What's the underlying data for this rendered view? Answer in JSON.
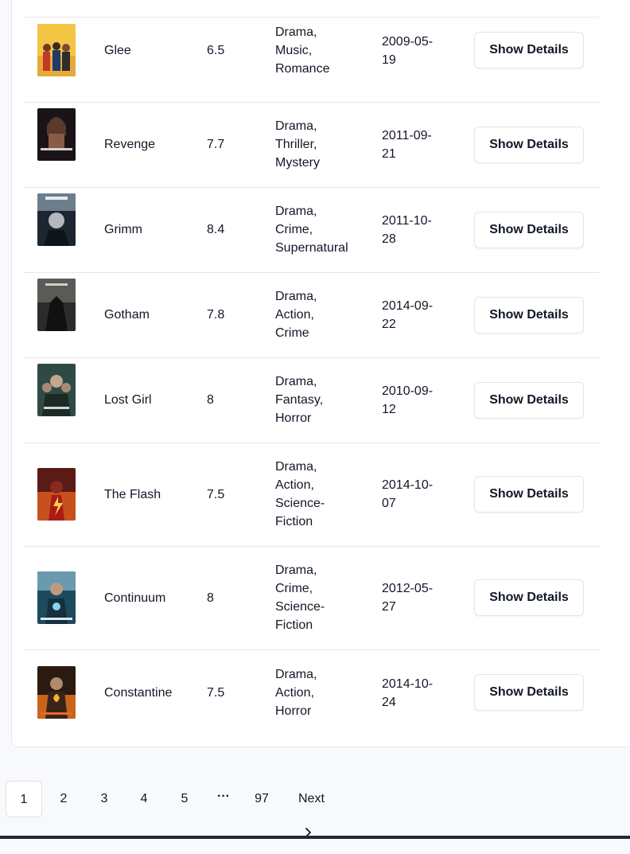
{
  "table": {
    "button_label": "Show Details",
    "rows": [
      {
        "name": "Glee",
        "rating": "6.5",
        "genres": [
          "Drama,",
          "Music,",
          "Romance"
        ],
        "date": [
          "2009-05-",
          "19"
        ],
        "poster_icon": "glee-poster"
      },
      {
        "name": "Revenge",
        "rating": "7.7",
        "genres": [
          "Drama,",
          "Thriller,",
          "Mystery"
        ],
        "date": [
          "2011-09-",
          "21"
        ],
        "poster_icon": "revenge-poster"
      },
      {
        "name": "Grimm",
        "rating": "8.4",
        "genres": [
          "Drama,",
          "Crime,",
          "Supernatural"
        ],
        "date": [
          "2011-10-",
          "28"
        ],
        "poster_icon": "grimm-poster"
      },
      {
        "name": "Gotham",
        "rating": "7.8",
        "genres": [
          "Drama,",
          "Action,",
          "Crime"
        ],
        "date": [
          "2014-09-",
          "22"
        ],
        "poster_icon": "gotham-poster"
      },
      {
        "name": "Lost Girl",
        "rating": "8",
        "genres": [
          "Drama,",
          "Fantasy,",
          "Horror"
        ],
        "date": [
          "2010-09-",
          "12"
        ],
        "poster_icon": "lost-girl-poster"
      },
      {
        "name": "The Flash",
        "rating": "7.5",
        "genres": [
          "Drama,",
          "Action,",
          "Science-",
          "Fiction"
        ],
        "date": [
          "2014-10-",
          "07"
        ],
        "poster_icon": "the-flash-poster"
      },
      {
        "name": "Continuum",
        "rating": "8",
        "genres": [
          "Drama,",
          "Crime,",
          "Science-",
          "Fiction"
        ],
        "date": [
          "2012-05-",
          "27"
        ],
        "poster_icon": "continuum-poster"
      },
      {
        "name": "Constantine",
        "rating": "7.5",
        "genres": [
          "Drama,",
          "Action,",
          "Horror"
        ],
        "date": [
          "2014-10-",
          "24"
        ],
        "poster_icon": "constantine-poster"
      }
    ]
  },
  "pagination": {
    "pages": [
      "1",
      "2",
      "3",
      "4",
      "5"
    ],
    "ellipsis": "···",
    "last_page": "97",
    "next_label": "Next",
    "current_page": "1"
  },
  "colors": {
    "border": "#e5e7eb",
    "text": "#111827",
    "page_bg": "#f8f9fc"
  }
}
